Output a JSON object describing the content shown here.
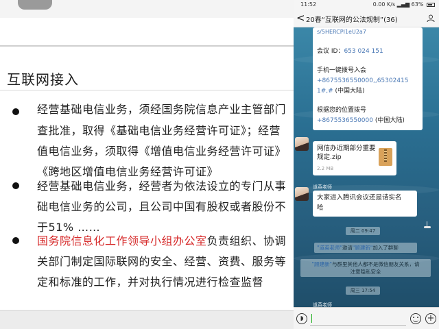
{
  "slide": {
    "title": "互联网接入",
    "bullets": [
      {
        "lines": [
          "经营基础电信业务，须经国务院信息产业主管部门",
          "查批准，取得《基础电信业务经营许可证》；经营",
          "值电信业务，须取得《增值电信业务经营许可证》",
          "《跨地区增值电信业务经营许可证》"
        ]
      },
      {
        "lines": [
          "经营基础电信业务，经营者为依法设立的专门从事",
          "础电信业务的公司，且公司中国有股权或者股份不",
          "于51% ……"
        ]
      },
      {
        "highlight": "国务院信息化工作领导小组办公室",
        "rest": "负责组织、协调",
        "lines": [
          "关部门制定国际联网的安全、经营、资费、服务等",
          "定和标准的工作，并对执行情况进行检查监督"
        ]
      }
    ]
  },
  "phone": {
    "status": {
      "time": "11:52",
      "speed": "0.00 K/s",
      "battery": "63%"
    },
    "nav": {
      "back": "<",
      "title": "20春“互联网的公法规制”(36)"
    },
    "meeting_bubble": {
      "link_fragment": "s/5HERCPI1eU2a7",
      "meeting_id_label": "会议 ID：",
      "meeting_id": "653 024 151",
      "oneclick_label": "手机一键拨号入会",
      "oneclick_line1": "+8675536550000,,65302415",
      "oneclick_line2": "1#,#",
      "oneclick_region": "(中国大陆)",
      "location_label": "根据您的位置拨号",
      "location_number": "+8675536550000",
      "location_region": "(中国大陆)"
    },
    "file_message": {
      "sender": "道英老师",
      "file_name_line1": "网信办近期部分重要",
      "file_name_line2": "规定.zip",
      "file_size": "2.2 MB"
    },
    "text_message": {
      "sender": "道英老师",
      "line1": "大家进入腾讯会议还是请实名",
      "line2": "哈"
    },
    "time_1": "周二 09:47",
    "invite": {
      "inviter": "\"道英老师\"",
      "verb": "邀请",
      "invitee": "\"顾建新\"",
      "tail": "加入了群聊"
    },
    "notice": {
      "name": "\"顾建新\"",
      "line1_rest": "与群里其他人都不是微信朋友关系，请",
      "line2": "注意隐私安全"
    },
    "time_2": "周三 17:54",
    "partial_sender": "道英老师"
  }
}
